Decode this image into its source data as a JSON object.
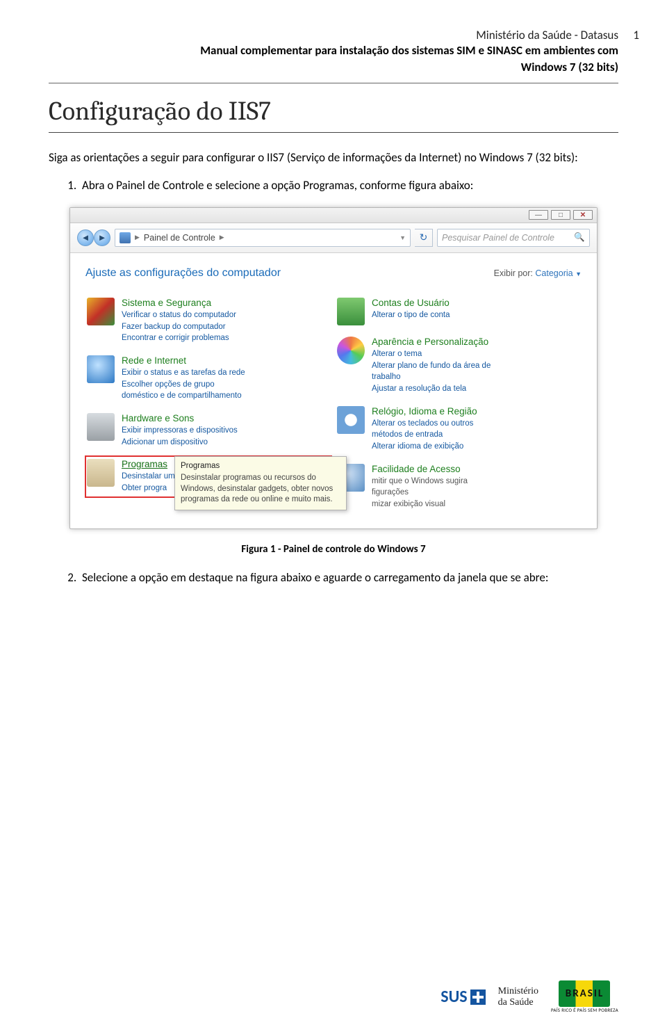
{
  "header": {
    "ministerio": "Ministério da Saúde - Datasus",
    "page_num": "1",
    "manual_line": "Manual complementar para instalação dos sistemas SIM e SINASC em ambientes com",
    "manual_line2": "Windows 7 (32 bits)"
  },
  "title": "Configuração do IIS7",
  "intro": "Siga as orientações a seguir para configurar o IIS7 (Serviço de informações da Internet) no Windows 7 (32 bits):",
  "steps": {
    "s1": "Abra o Painel de Controle e selecione a opção Programas, conforme figura abaixo:",
    "s2": "Selecione a opção em destaque na figura abaixo e aguarde o carregamento da janela que se abre:"
  },
  "figure_caption": "Figura 1 - Painel de controle do Windows 7",
  "cp": {
    "breadcrumb": "Painel de Controle",
    "search_placeholder": "Pesquisar Painel de Controle",
    "heading": "Ajuste as configurações do computador",
    "viewby_label": "Exibir por:",
    "viewby_value": "Categoria",
    "left": [
      {
        "title": "Sistema e Segurança",
        "subs": [
          "Verificar o status do computador",
          "Fazer backup do computador",
          "Encontrar e corrigir problemas"
        ]
      },
      {
        "title": "Rede e Internet",
        "subs": [
          "Exibir o status e as tarefas da rede",
          "Escolher opções de grupo",
          "doméstico e de compartilhamento"
        ]
      },
      {
        "title": "Hardware e Sons",
        "subs": [
          "Exibir impressoras e dispositivos",
          "Adicionar um dispositivo"
        ]
      },
      {
        "title": "Programas",
        "subs": [
          "Desinstalar um programa",
          "Obter progra"
        ]
      }
    ],
    "right": [
      {
        "title": "Contas de Usuário",
        "subs": [
          "Alterar o tipo de conta"
        ]
      },
      {
        "title": "Aparência e Personalização",
        "subs": [
          "Alterar o tema",
          "Alterar plano de fundo da área de",
          "trabalho",
          "Ajustar a resolução da tela"
        ]
      },
      {
        "title": "Relógio, Idioma e Região",
        "subs": [
          "Alterar os teclados ou outros",
          "métodos de entrada",
          "Alterar idioma de exibição"
        ]
      },
      {
        "title": "Facilidade de Acesso",
        "subs": [
          "mitir que o Windows sugira",
          "figurações",
          "mizar exibição visual"
        ]
      }
    ],
    "tooltip": {
      "title": "Programas",
      "body": "Desinstalar programas ou recursos do Windows, desinstalar gadgets, obter novos programas da rede ou online e muito mais."
    }
  },
  "footer": {
    "sus": "SUS",
    "ms_line1": "Ministério",
    "ms_line2": "da Saúde",
    "br_line1": "BRASIL",
    "br_line2": "PAÍS RICO É PAÍS SEM POBREZA"
  }
}
